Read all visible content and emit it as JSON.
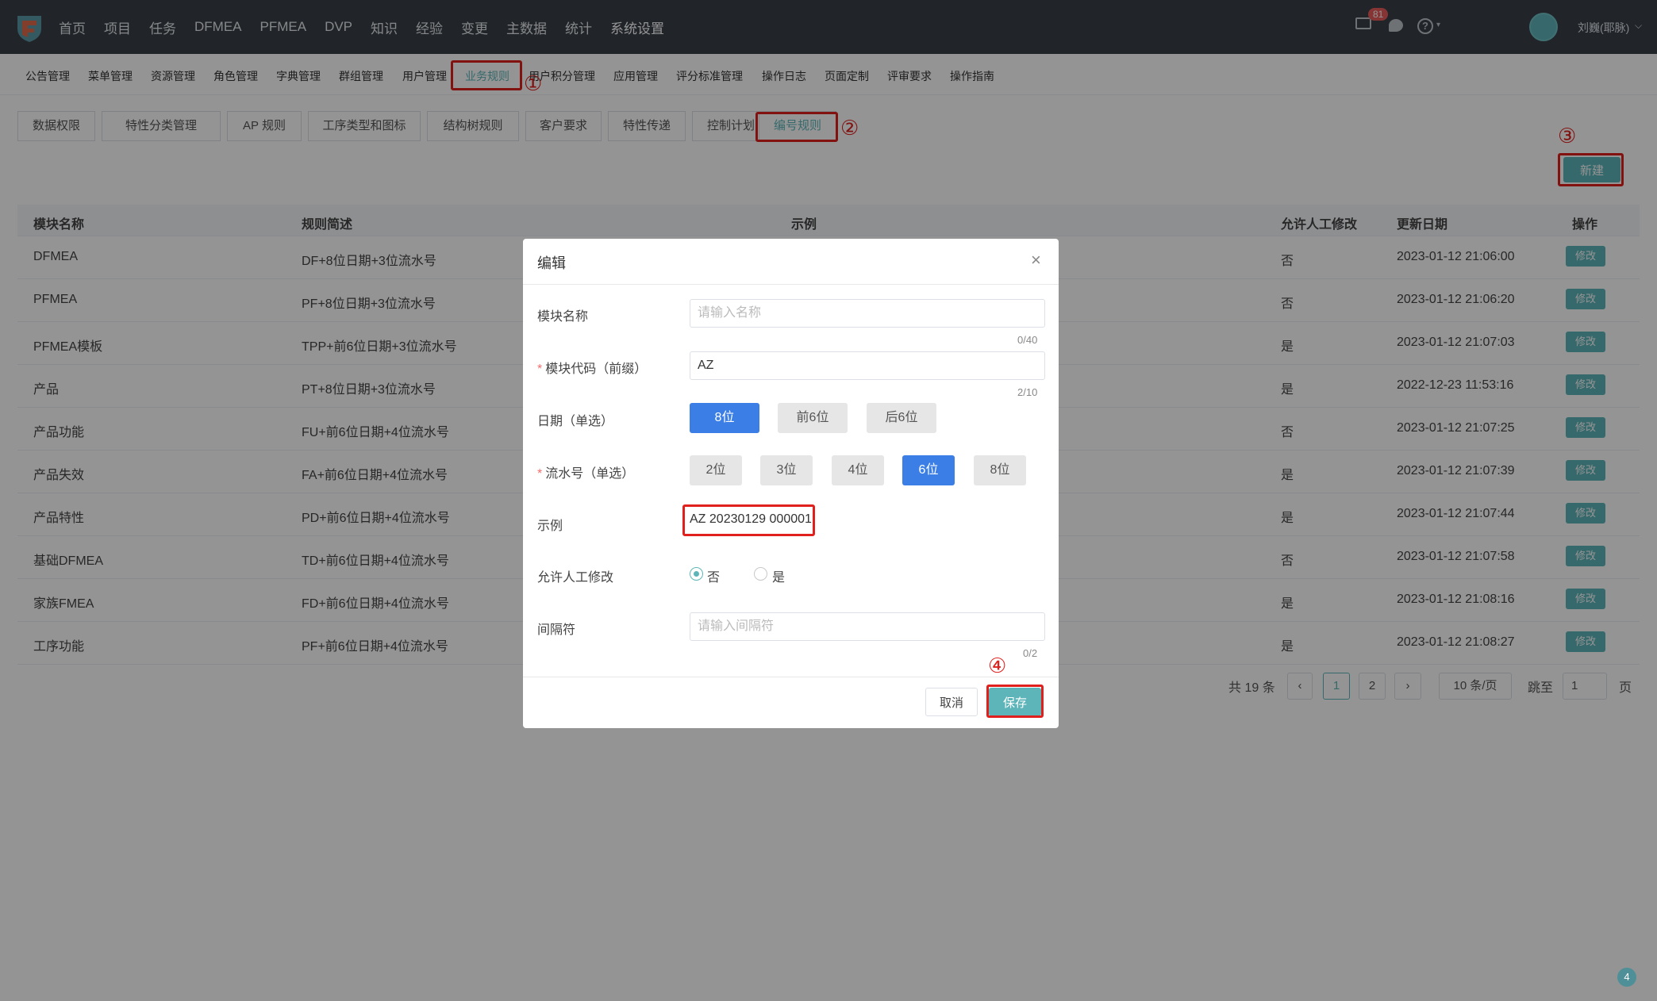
{
  "topnav": {
    "items": [
      "首页",
      "项目",
      "任务",
      "DFMEA",
      "PFMEA",
      "DVP",
      "知识",
      "经验",
      "变更",
      "主数据",
      "统计",
      "系统设置"
    ],
    "mail_badge": "81",
    "user_name": "刘巍(耶脉)"
  },
  "subnav": {
    "items": [
      "公告管理",
      "菜单管理",
      "资源管理",
      "角色管理",
      "字典管理",
      "群组管理",
      "用户管理",
      "业务规则",
      "用户积分管理",
      "应用管理",
      "评分标准管理",
      "操作日志",
      "页面定制",
      "评审要求",
      "操作指南"
    ]
  },
  "tabs": [
    "数据权限",
    "特性分类管理",
    "AP 规则",
    "工序类型和图标",
    "结构树规则",
    "客户要求",
    "特性传递",
    "控制计划",
    "编号规则"
  ],
  "new_button": "新建",
  "table": {
    "headers": [
      "模块名称",
      "规则简述",
      "示例",
      "允许人工修改",
      "更新日期",
      "操作"
    ],
    "rows": [
      {
        "name": "DFMEA",
        "rule": "DF+8位日期+3位流水号",
        "allow": "否",
        "date": "2023-01-12 21:06:00",
        "action": "修改"
      },
      {
        "name": "PFMEA",
        "rule": "PF+8位日期+3位流水号",
        "allow": "否",
        "date": "2023-01-12 21:06:20",
        "action": "修改"
      },
      {
        "name": "PFMEA模板",
        "rule": "TPP+前6位日期+3位流水号",
        "allow": "是",
        "date": "2023-01-12 21:07:03",
        "action": "修改"
      },
      {
        "name": "产品",
        "rule": "PT+8位日期+3位流水号",
        "allow": "是",
        "date": "2022-12-23 11:53:16",
        "action": "修改"
      },
      {
        "name": "产品功能",
        "rule": "FU+前6位日期+4位流水号",
        "allow": "否",
        "date": "2023-01-12 21:07:25",
        "action": "修改"
      },
      {
        "name": "产品失效",
        "rule": "FA+前6位日期+4位流水号",
        "allow": "是",
        "date": "2023-01-12 21:07:39",
        "action": "修改"
      },
      {
        "name": "产品特性",
        "rule": "PD+前6位日期+4位流水号",
        "allow": "是",
        "date": "2023-01-12 21:07:44",
        "action": "修改"
      },
      {
        "name": "基础DFMEA",
        "rule": "TD+前6位日期+4位流水号",
        "allow": "否",
        "date": "2023-01-12 21:07:58",
        "action": "修改"
      },
      {
        "name": "家族FMEA",
        "rule": "FD+前6位日期+4位流水号",
        "allow": "是",
        "date": "2023-01-12 21:08:16",
        "action": "修改"
      },
      {
        "name": "工序功能",
        "rule": "PF+前6位日期+4位流水号",
        "allow": "是",
        "date": "2023-01-12 21:08:27",
        "action": "修改"
      }
    ]
  },
  "pagination": {
    "total": "共 19 条",
    "prev": "‹",
    "pages": [
      "1",
      "2"
    ],
    "next": "›",
    "page_size": "10 条/页",
    "jump_label": "跳至",
    "jump_value": "1",
    "page_suffix": "页"
  },
  "dialog": {
    "title": "编辑",
    "close": "×",
    "module_name": {
      "label": "模块名称",
      "placeholder": "请输入名称",
      "value": "",
      "counter": "0/40"
    },
    "module_code": {
      "label": "模块代码（前缀）",
      "value": "AZ",
      "counter": "2/10"
    },
    "date": {
      "label": "日期（单选）",
      "options": [
        "8位",
        "前6位",
        "后6位"
      ],
      "selected": "8位"
    },
    "serial": {
      "label": "流水号（单选）",
      "options": [
        "2位",
        "3位",
        "4位",
        "6位",
        "8位"
      ],
      "selected": "6位"
    },
    "example": {
      "label": "示例",
      "value": "AZ 20230129 000001"
    },
    "manual": {
      "label": "允许人工修改",
      "options": [
        "否",
        "是"
      ],
      "selected": "否"
    },
    "separator": {
      "label": "间隔符",
      "placeholder": "请输入间隔符",
      "value": "",
      "counter": "0/2"
    },
    "cancel": "取消",
    "save": "保存"
  },
  "annotations": [
    "①",
    "②",
    "③",
    "④"
  ],
  "corner_badge": "4",
  "colors": {
    "accent": "#5eb5b9",
    "selected_option": "#3a7ee6",
    "annotation": "#e0201c",
    "topbar": "#3a4049"
  }
}
